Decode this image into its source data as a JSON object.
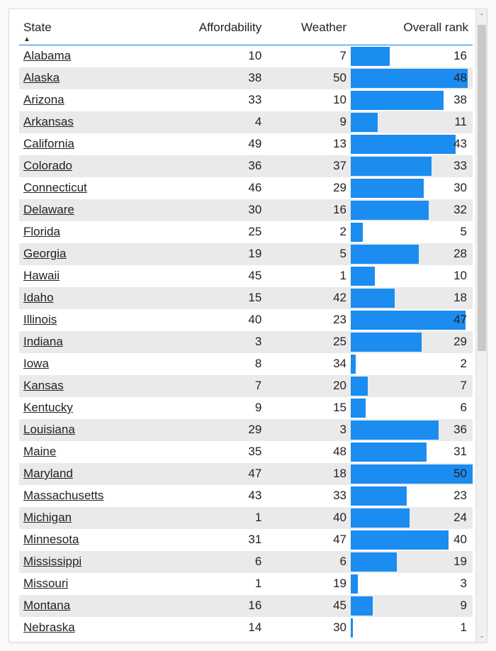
{
  "headers": {
    "state": "State",
    "affordability": "Affordability",
    "weather": "Weather",
    "rank": "Overall rank"
  },
  "chart_data": {
    "type": "table",
    "title": "",
    "columns": [
      "State",
      "Affordability",
      "Weather",
      "Overall rank"
    ],
    "rank_bar_max": 50,
    "rows": [
      {
        "state": "Alabama",
        "affordability": 10,
        "weather": 7,
        "rank": 16
      },
      {
        "state": "Alaska",
        "affordability": 38,
        "weather": 50,
        "rank": 48
      },
      {
        "state": "Arizona",
        "affordability": 33,
        "weather": 10,
        "rank": 38
      },
      {
        "state": "Arkansas",
        "affordability": 4,
        "weather": 9,
        "rank": 11
      },
      {
        "state": "California",
        "affordability": 49,
        "weather": 13,
        "rank": 43
      },
      {
        "state": "Colorado",
        "affordability": 36,
        "weather": 37,
        "rank": 33
      },
      {
        "state": "Connecticut",
        "affordability": 46,
        "weather": 29,
        "rank": 30
      },
      {
        "state": "Delaware",
        "affordability": 30,
        "weather": 16,
        "rank": 32
      },
      {
        "state": "Florida",
        "affordability": 25,
        "weather": 2,
        "rank": 5
      },
      {
        "state": "Georgia",
        "affordability": 19,
        "weather": 5,
        "rank": 28
      },
      {
        "state": "Hawaii",
        "affordability": 45,
        "weather": 1,
        "rank": 10
      },
      {
        "state": "Idaho",
        "affordability": 15,
        "weather": 42,
        "rank": 18
      },
      {
        "state": "Illinois",
        "affordability": 40,
        "weather": 23,
        "rank": 47
      },
      {
        "state": "Indiana",
        "affordability": 3,
        "weather": 25,
        "rank": 29
      },
      {
        "state": "Iowa",
        "affordability": 8,
        "weather": 34,
        "rank": 2
      },
      {
        "state": "Kansas",
        "affordability": 7,
        "weather": 20,
        "rank": 7
      },
      {
        "state": "Kentucky",
        "affordability": 9,
        "weather": 15,
        "rank": 6
      },
      {
        "state": "Louisiana",
        "affordability": 29,
        "weather": 3,
        "rank": 36
      },
      {
        "state": "Maine",
        "affordability": 35,
        "weather": 48,
        "rank": 31
      },
      {
        "state": "Maryland",
        "affordability": 47,
        "weather": 18,
        "rank": 50
      },
      {
        "state": "Massachusetts",
        "affordability": 43,
        "weather": 33,
        "rank": 23
      },
      {
        "state": "Michigan",
        "affordability": 1,
        "weather": 40,
        "rank": 24
      },
      {
        "state": "Minnesota",
        "affordability": 31,
        "weather": 47,
        "rank": 40
      },
      {
        "state": "Mississippi",
        "affordability": 6,
        "weather": 6,
        "rank": 19
      },
      {
        "state": "Missouri",
        "affordability": 1,
        "weather": 19,
        "rank": 3
      },
      {
        "state": "Montana",
        "affordability": 16,
        "weather": 45,
        "rank": 9
      },
      {
        "state": "Nebraska",
        "affordability": 14,
        "weather": 30,
        "rank": 1
      }
    ]
  },
  "bar_color": "#1b8cf0"
}
